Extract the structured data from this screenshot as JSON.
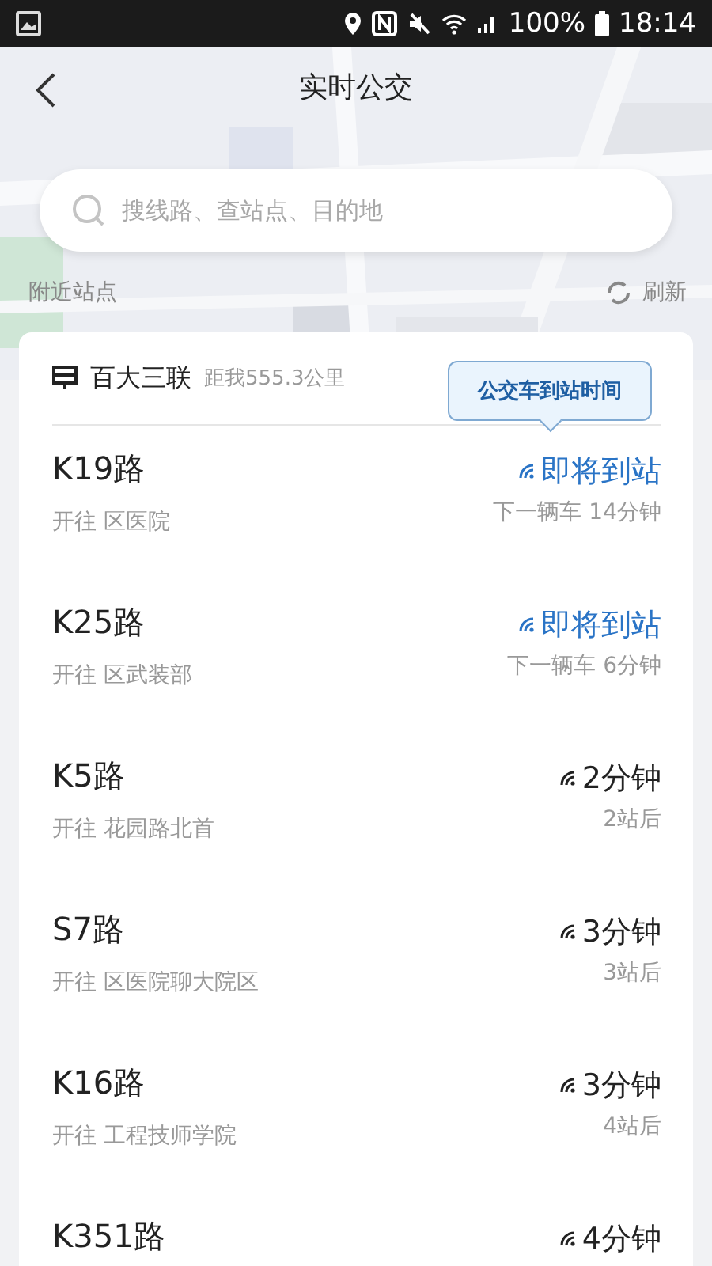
{
  "status_bar": {
    "battery": "100%",
    "time": "18:14"
  },
  "header": {
    "title": "实时公交"
  },
  "search": {
    "placeholder": "搜线路、查站点、目的地"
  },
  "nearby": {
    "label": "附近站点",
    "refresh": "刷新"
  },
  "stop": {
    "name": "百大三联",
    "distance": "距我555.3公里",
    "tooltip": "公交车到站时间",
    "routes": [
      {
        "route": "K19路",
        "destination": "开往 区医院",
        "kind": "soon",
        "arrival": "即将到站",
        "detail": "下一辆车 14分钟"
      },
      {
        "route": "K25路",
        "destination": "开往 区武装部",
        "kind": "soon",
        "arrival": "即将到站",
        "detail": "下一辆车 6分钟"
      },
      {
        "route": "K5路",
        "destination": "开往 花园路北首",
        "kind": "minutes",
        "arrival": "2分钟",
        "detail": "2站后"
      },
      {
        "route": "S7路",
        "destination": "开往 区医院聊大院区",
        "kind": "minutes",
        "arrival": "3分钟",
        "detail": "3站后"
      },
      {
        "route": "K16路",
        "destination": "开往 工程技师学院",
        "kind": "minutes",
        "arrival": "3分钟",
        "detail": "4站后"
      },
      {
        "route": "K351路",
        "kind": "minutes",
        "arrival": "4分钟"
      }
    ]
  }
}
